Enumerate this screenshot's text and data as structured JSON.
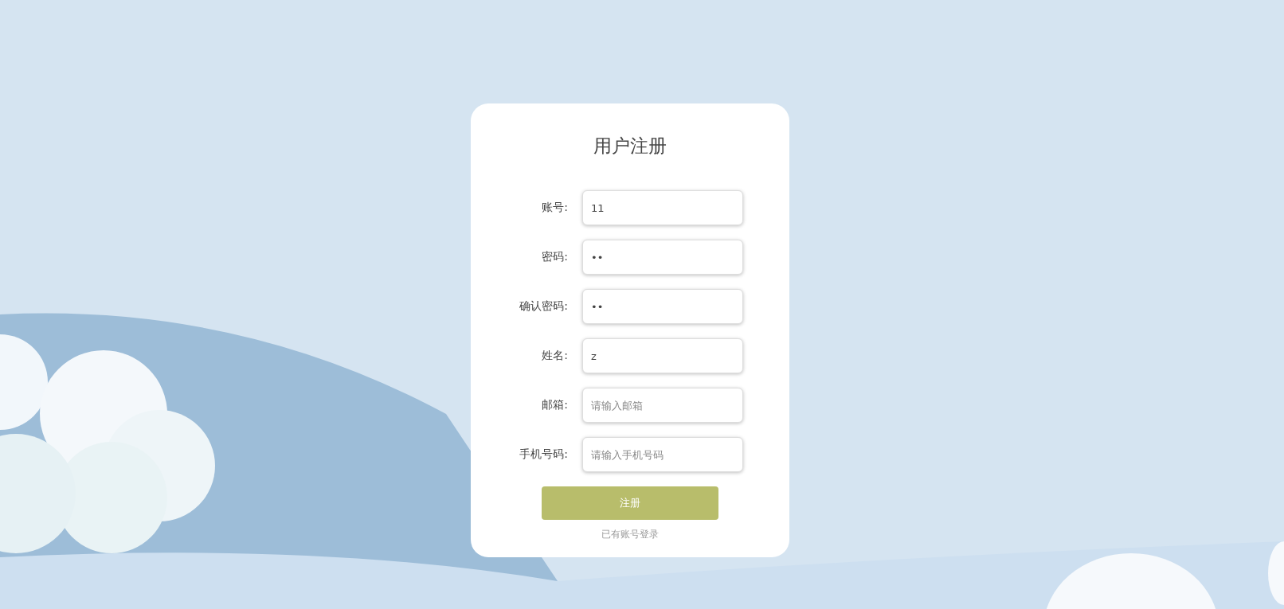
{
  "title": "用户注册",
  "fields": [
    {
      "label": "账号:",
      "value": "11"
    },
    {
      "label": "密码:",
      "value": "••"
    },
    {
      "label": "确认密码:",
      "value": "••"
    },
    {
      "label": "姓名:",
      "value": "z"
    },
    {
      "label": "邮箱:",
      "placeholder": "请输入邮箱"
    },
    {
      "label": "手机号码:",
      "placeholder": "请输入手机号码"
    }
  ],
  "submit_button": "注册",
  "login_link": "已有账号登录"
}
